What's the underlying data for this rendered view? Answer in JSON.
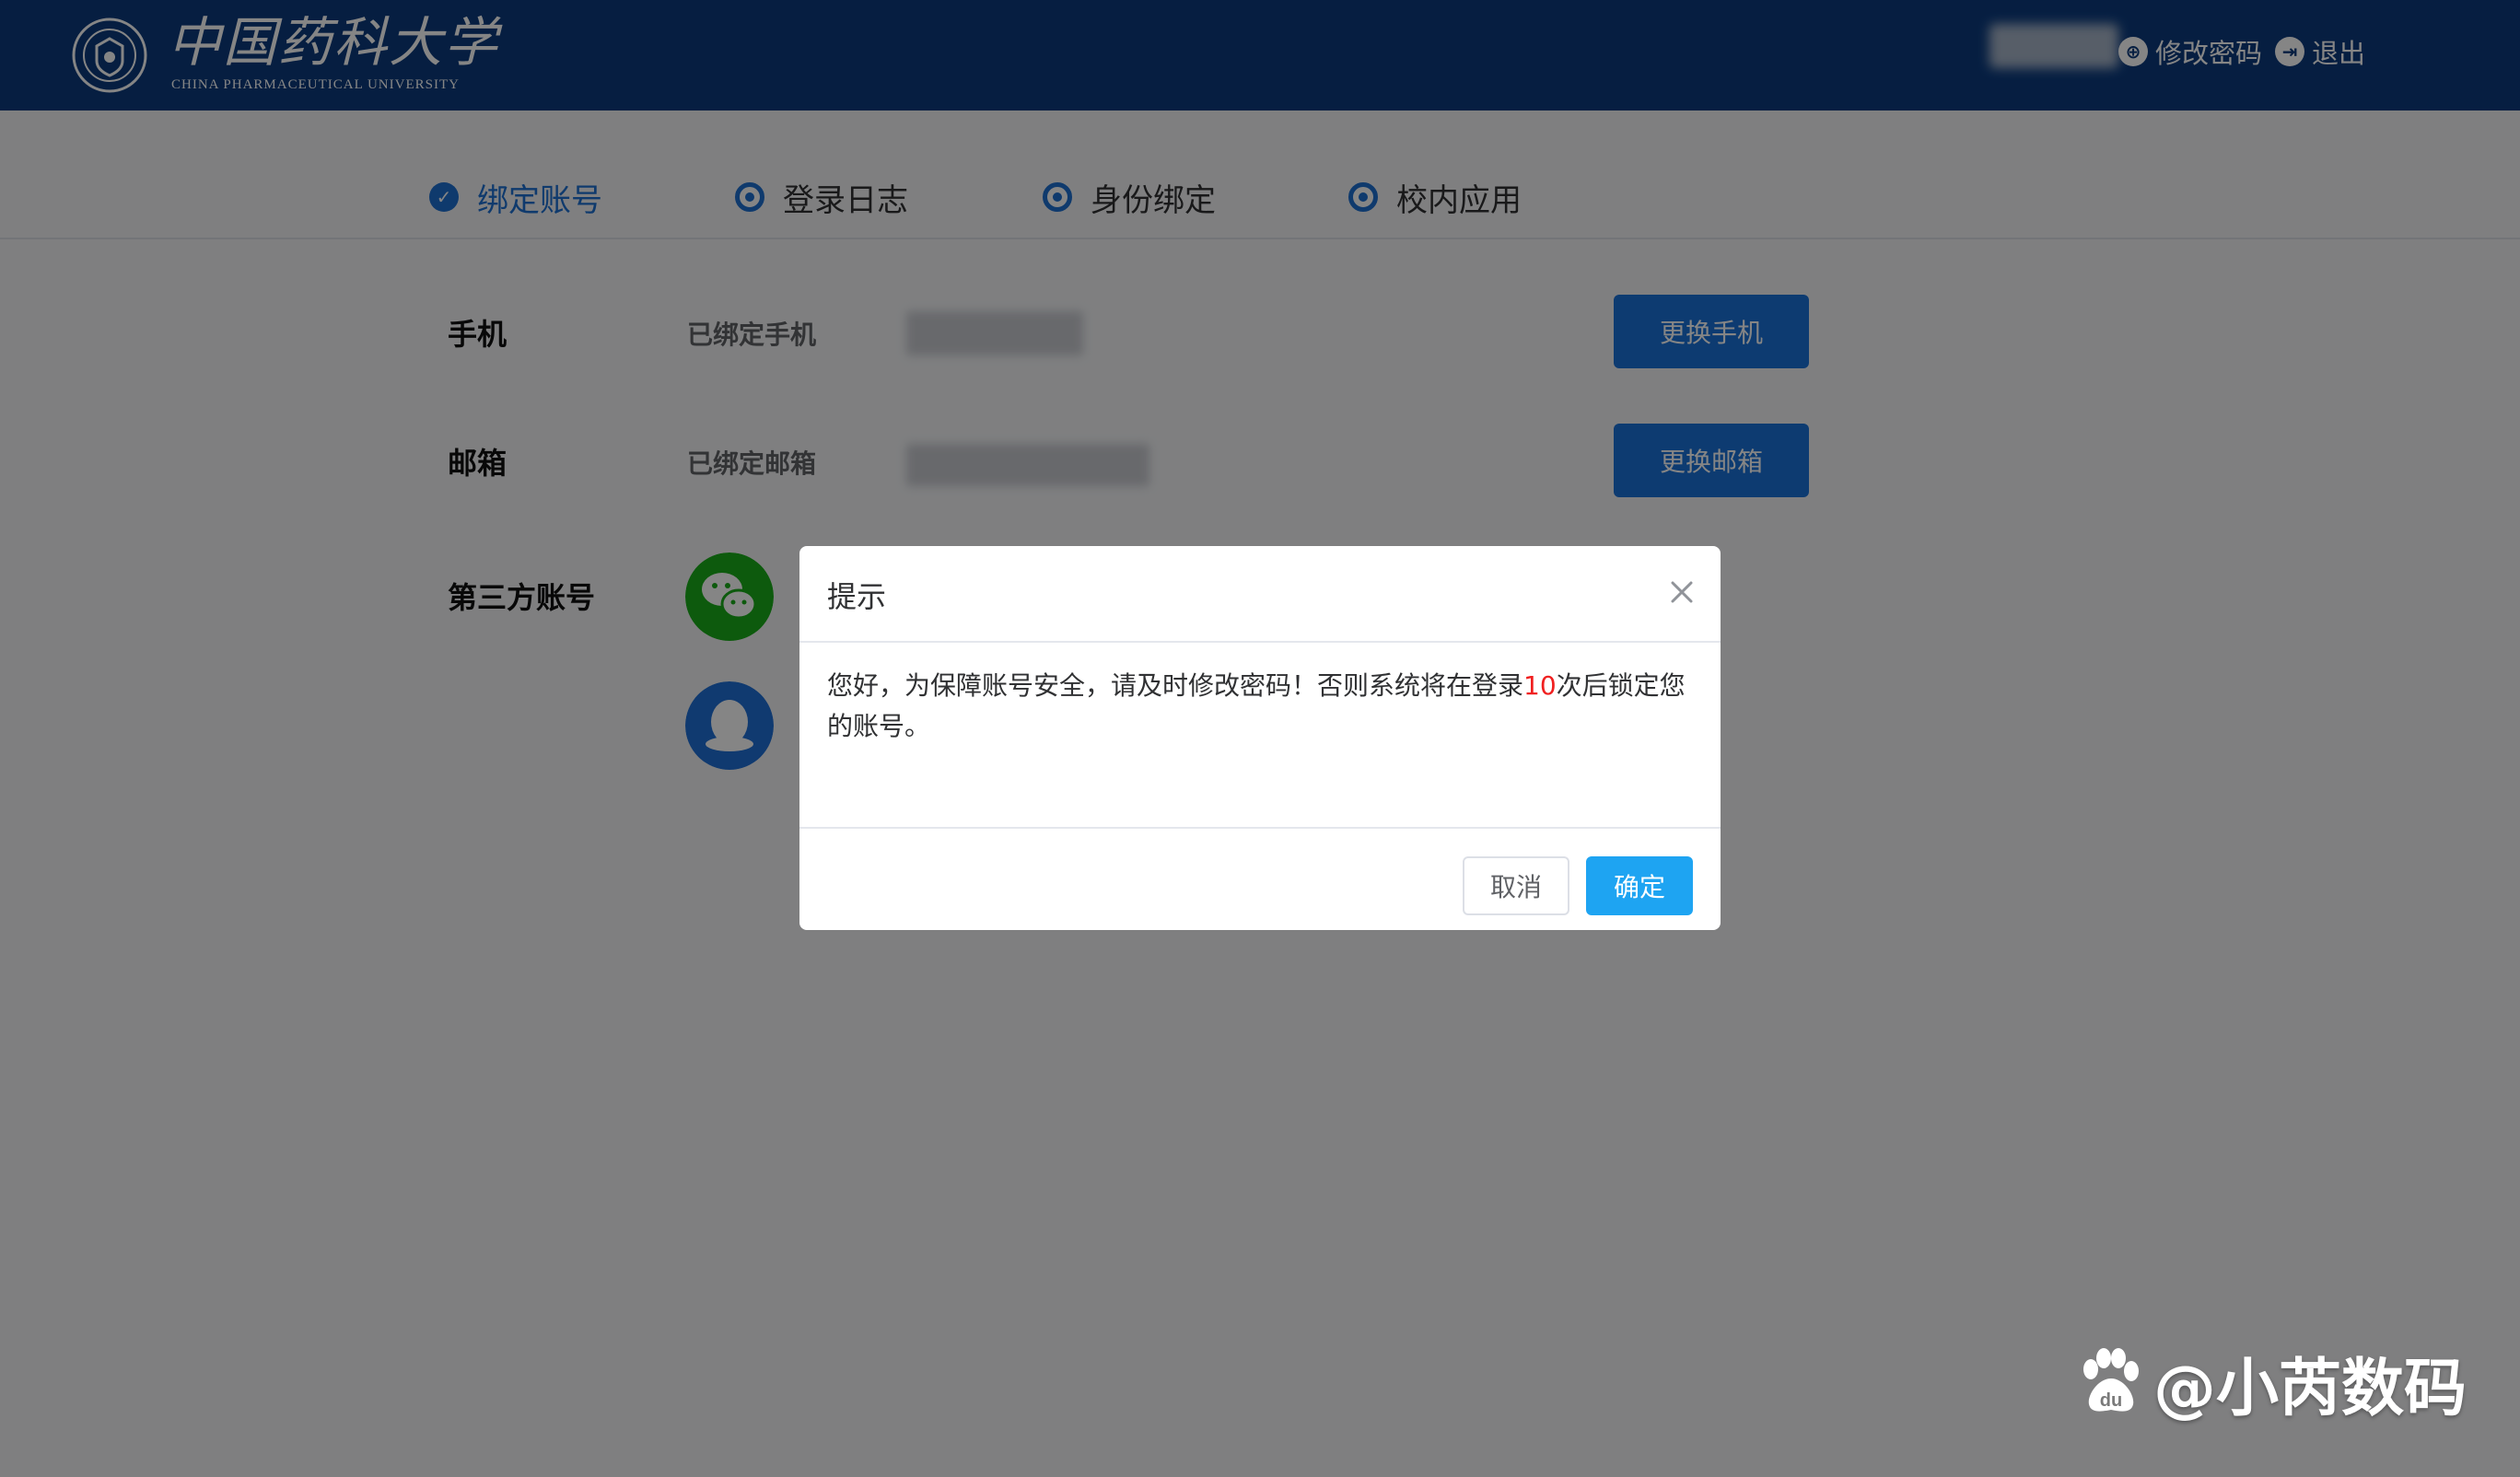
{
  "header": {
    "logo_cn": "中国药科大学",
    "logo_en": "CHINA PHARMACEUTICAL UNIVERSITY",
    "change_password": "修改密码",
    "logout": "退出"
  },
  "tabs": [
    {
      "label": "绑定账号",
      "active": true
    },
    {
      "label": "登录日志",
      "active": false
    },
    {
      "label": "身份绑定",
      "active": false
    },
    {
      "label": "校内应用",
      "active": false
    }
  ],
  "rows": {
    "phone": {
      "label": "手机",
      "status": "已绑定手机",
      "button": "更换手机"
    },
    "email": {
      "label": "邮箱",
      "status": "已绑定邮箱",
      "button": "更换邮箱"
    },
    "third_party": {
      "label": "第三方账号"
    }
  },
  "dialog": {
    "title": "提示",
    "message_before": "您好，为保障账号安全，请及时修改密码！否则系统将在登录",
    "message_count": "10",
    "message_after": "次后锁定您的账号。",
    "cancel": "取消",
    "confirm": "确定"
  },
  "watermark": {
    "text": "@小芮数码"
  },
  "icons": [
    "university-emblem-icon",
    "lock-icon",
    "exit-icon",
    "check-icon",
    "radio-icon",
    "wechat-icon",
    "qq-icon",
    "close-icon",
    "baidu-paw-icon"
  ],
  "colors": {
    "header_bg": "#0c3b7e",
    "accent": "#1e6fd1",
    "confirm": "#1ea4f2",
    "warning": "#f02020",
    "wechat": "#1aad19",
    "qq": "#1f6fd6"
  }
}
